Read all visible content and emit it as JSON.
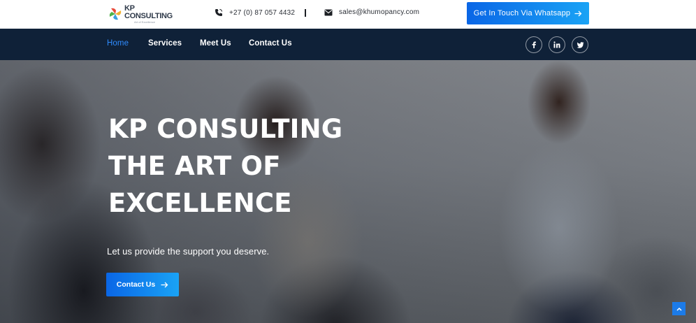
{
  "brand": {
    "name": "KP CONSULTING",
    "tagline": "Art of Excellence"
  },
  "topbar": {
    "phone": "+27 (0) 87 057 4432",
    "email": "sales@khumopancy.com",
    "whatsapp_label": "Get In Touch Via Whatsapp"
  },
  "nav": {
    "items": [
      {
        "label": "Home",
        "active": true
      },
      {
        "label": "Services",
        "active": false
      },
      {
        "label": "Meet Us",
        "active": false
      },
      {
        "label": "Contact Us",
        "active": false
      }
    ],
    "social": [
      "facebook-icon",
      "linkedin-icon",
      "twitter-icon"
    ]
  },
  "hero": {
    "title_lines": [
      "KP CONSULTING",
      "THE ART OF",
      "EXCELLENCE"
    ],
    "subtitle": "Let us provide the support you deserve.",
    "cta_label": "Contact Us"
  },
  "colors": {
    "navbar": "#0f2138",
    "accent": "#2f8cff",
    "button_start": "#0a66e6",
    "button_end": "#1aa3f5"
  }
}
